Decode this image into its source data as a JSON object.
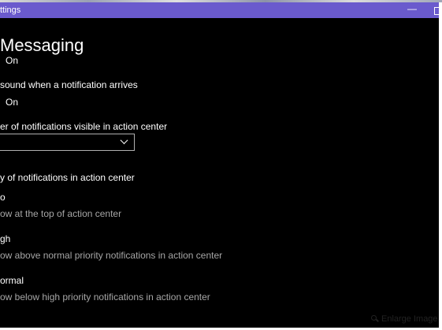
{
  "window": {
    "title": "ttings",
    "minimize_glyph": "—"
  },
  "page": {
    "title": "Messaging"
  },
  "settings": {
    "notifications_state": "On",
    "sound_label": "sound when a notification arrives",
    "sound_state": "On",
    "visible_count_label": "er of notifications visible in action center",
    "visible_count_value": "",
    "priority_label": "y of notifications in action center"
  },
  "priority_options": [
    {
      "title": "o",
      "description": "ow at the top of action center"
    },
    {
      "title": "gh",
      "description": "ow above normal priority notifications in action center"
    },
    {
      "title": "ormal",
      "description": "ow below high priority notifications in action center"
    }
  ],
  "overlay": {
    "enlarge_label": "Enlarge Image"
  },
  "colors": {
    "titlebar": "#6a5acd",
    "background": "#000000",
    "secondary_text": "#a6a6a6"
  }
}
